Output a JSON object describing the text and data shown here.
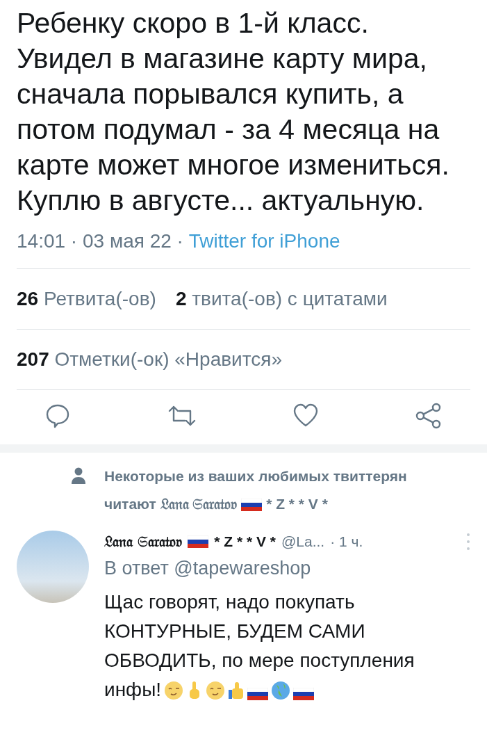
{
  "tweet": {
    "paragraphs": [
      "Ребенку скоро в 1-й класс.",
      "Увидел в магазине карту мира, сначала порывался купить, а потом подумал - за 4 месяца на карте может многое измениться.",
      "Куплю в августе... актуальную."
    ],
    "timestamp": "14:01 · 03 мая 22 ·",
    "source": "Twitter for iPhone",
    "stats_rows": [
      [
        {
          "count": "26",
          "label": "Ретвита(-ов)"
        },
        {
          "count": "2",
          "label": "твита(-ов) с цитатами"
        }
      ],
      [
        {
          "count": "207",
          "label": "Отметки(-ок) «Нравится»"
        }
      ]
    ]
  },
  "social_context": {
    "line_1": "Некоторые из ваших любимых твиттерян",
    "line_2": "читают 𝔏𝔞𝔫𝔞 𝔖𝔞𝔯𝔞𝔱𝔬𝔳",
    "name_suffix": "* Z * * V *"
  },
  "reply": {
    "name": "𝔏𝔞𝔫𝔞 𝔖𝔞𝔯𝔞𝔱𝔬𝔳",
    "name_suffix": "* Z * * V *",
    "handle": "@La...",
    "time": "· 1 ч.",
    "reply_to_label": "В ответ",
    "reply_to": "@tapewareshop",
    "text": "Щас говорят, надо покупать КОНТУРНЫЕ, БУДЕМ САМИ ОБВОДИТЬ,  по мере поступления",
    "text_end": "инфы!"
  }
}
